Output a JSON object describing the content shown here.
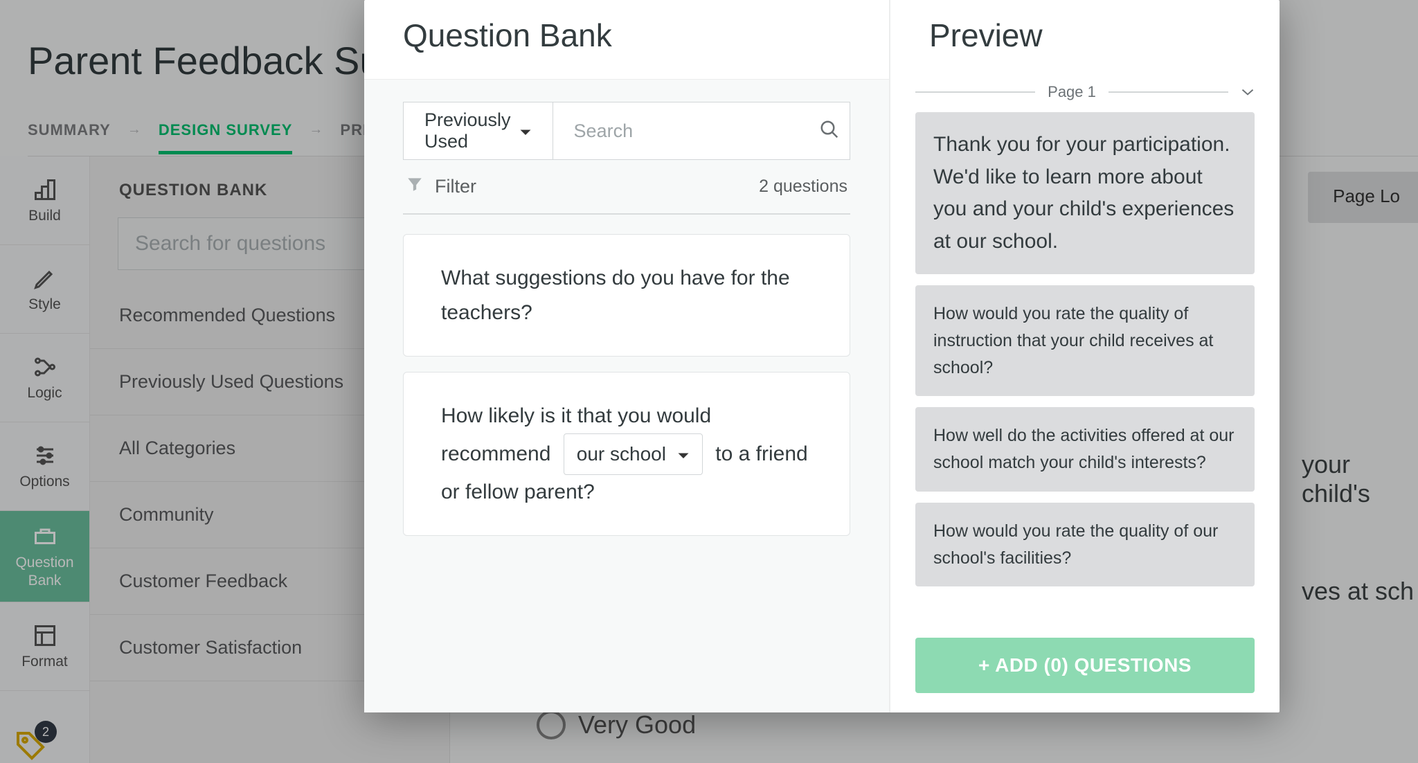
{
  "header": {
    "title": "Parent Feedback Survey"
  },
  "tabs": {
    "summary": "SUMMARY",
    "design": "DESIGN SURVEY",
    "preview": "PREVIEW"
  },
  "rail": {
    "build": "Build",
    "style": "Style",
    "logic": "Logic",
    "options": "Options",
    "qbank": "Question Bank",
    "format": "Format",
    "badge_count": "2"
  },
  "sidebar": {
    "title": "QUESTION BANK",
    "search_placeholder": "Search for questions",
    "items": {
      "recommended": "Recommended Questions",
      "previously_used": "Previously Used Questions",
      "all": "All Categories",
      "community": "Community",
      "cust_feedback": "Customer Feedback",
      "cust_satisfaction": "Customer Satisfaction"
    }
  },
  "bg_main": {
    "page_loop": "Page Lo",
    "snippet1": "your child's",
    "snippet2": "ves at sch",
    "radio": "Very Good"
  },
  "modal": {
    "qb": {
      "title": "Question Bank",
      "dropdown_selected": "Previously Used",
      "search_placeholder": "Search",
      "filter_label": "Filter",
      "count_label": "2 questions",
      "q1": "What suggestions do you have for the teachers?",
      "q2_prefix": "How likely is it that you would recommend",
      "q2_select": "our school",
      "q2_suffix": "to a friend or fellow parent?"
    },
    "preview": {
      "title": "Preview",
      "page_label": "Page 1",
      "cards": {
        "intro": "Thank you for your participation. We'd like to learn more about you and your child's experiences at our school.",
        "c1": "How would you rate the quality of instruction that your child receives at school?",
        "c2": "How well do the activities offered at our school match your child's interests?",
        "c3": "How would you rate the quality of our school's facilities?"
      },
      "add_button": "+ ADD (0) QUESTIONS"
    }
  }
}
